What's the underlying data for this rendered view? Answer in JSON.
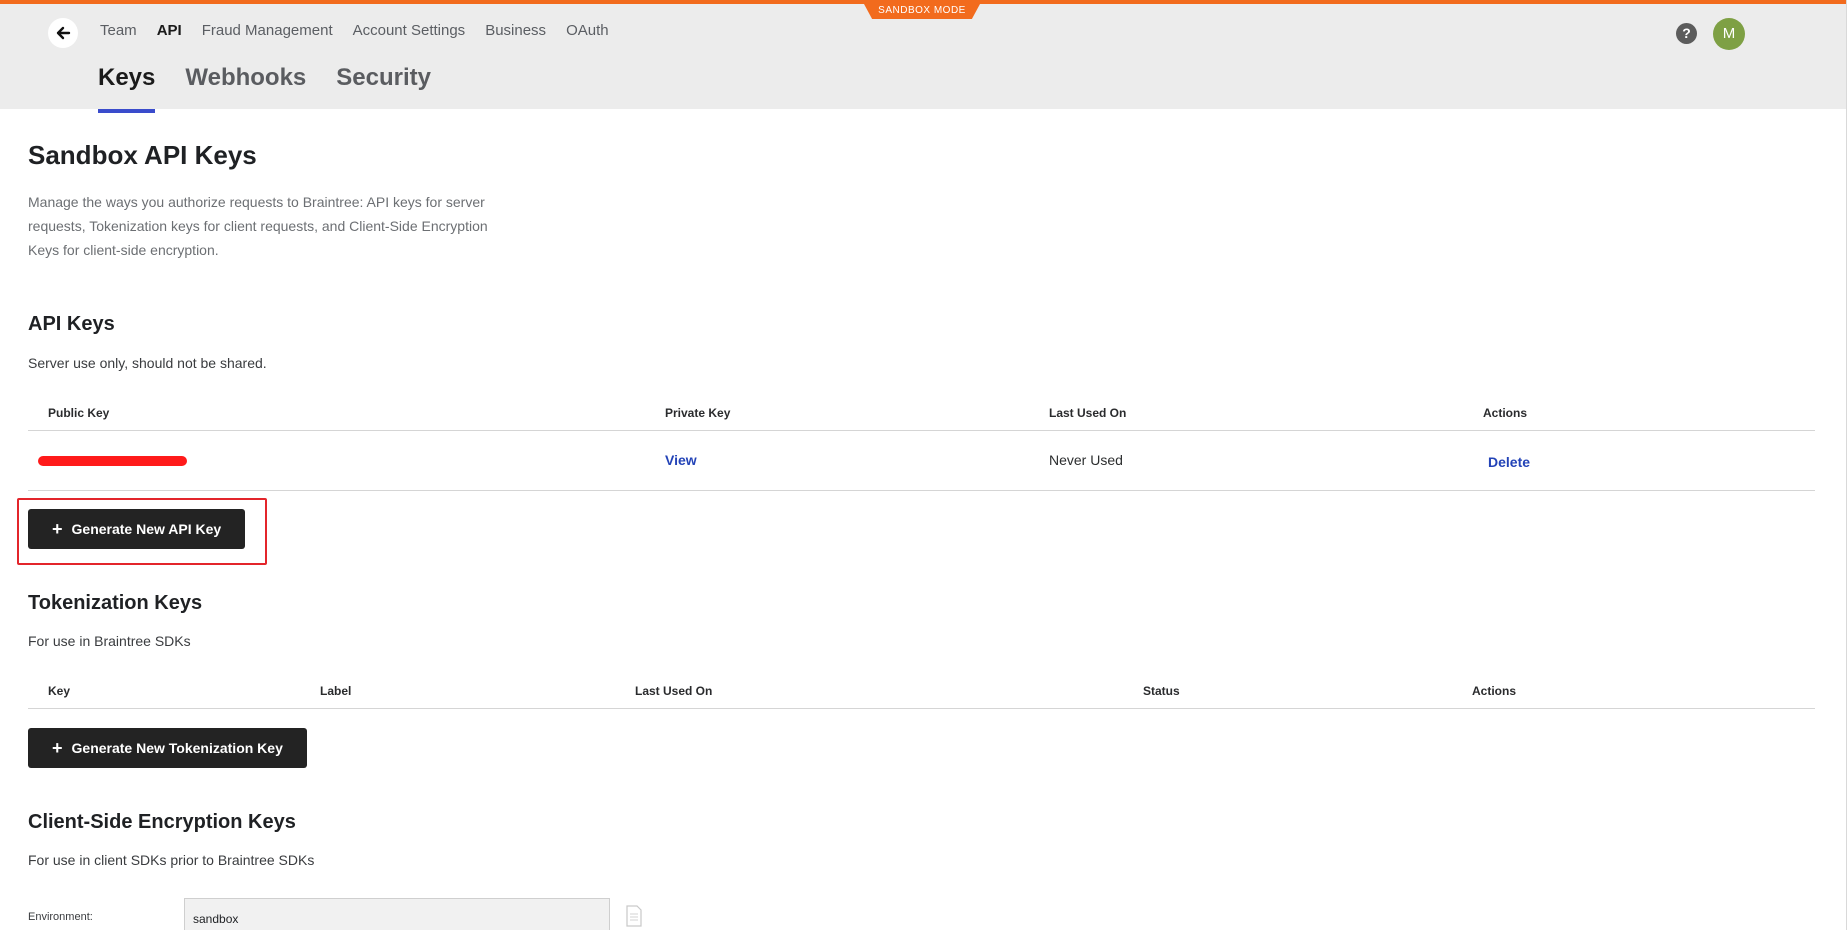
{
  "banner": {
    "mode_label": "SANDBOX MODE"
  },
  "nav": {
    "items": [
      {
        "label": "Team",
        "active": false
      },
      {
        "label": "API",
        "active": true
      },
      {
        "label": "Fraud Management",
        "active": false
      },
      {
        "label": "Account Settings",
        "active": false
      },
      {
        "label": "Business",
        "active": false
      },
      {
        "label": "OAuth",
        "active": false
      }
    ],
    "help_label": "?",
    "avatar_initial": "M"
  },
  "subtabs": [
    {
      "label": "Keys",
      "active": true
    },
    {
      "label": "Webhooks",
      "active": false
    },
    {
      "label": "Security",
      "active": false
    }
  ],
  "page": {
    "title": "Sandbox API Keys",
    "description": "Manage the ways you authorize requests to Braintree: API keys for server requests, Tokenization keys for client requests, and Client-Side Encryption Keys for client-side encryption."
  },
  "api_keys": {
    "title": "API Keys",
    "subtitle": "Server use only, should not be shared.",
    "headers": {
      "public_key": "Public Key",
      "private_key": "Private Key",
      "last_used": "Last Used On",
      "actions": "Actions"
    },
    "row": {
      "private_key": "View",
      "last_used": "Never Used",
      "action": "Delete"
    },
    "generate_label": "Generate New API Key"
  },
  "tokenization": {
    "title": "Tokenization Keys",
    "subtitle": "For use in Braintree SDKs",
    "headers": {
      "key": "Key",
      "label": "Label",
      "last_used": "Last Used On",
      "status": "Status",
      "actions": "Actions"
    },
    "generate_label": "Generate New Tokenization Key"
  },
  "cse": {
    "title": "Client-Side Encryption Keys",
    "subtitle": "For use in client SDKs prior to Braintree SDKs",
    "env_label": "Environment:",
    "env_value": "sandbox"
  },
  "colors": {
    "accent": "#f26b1d",
    "tab_underline": "#3a4ccc",
    "link": "#2343b7",
    "button": "#232323",
    "highlight": "#e3252b"
  }
}
